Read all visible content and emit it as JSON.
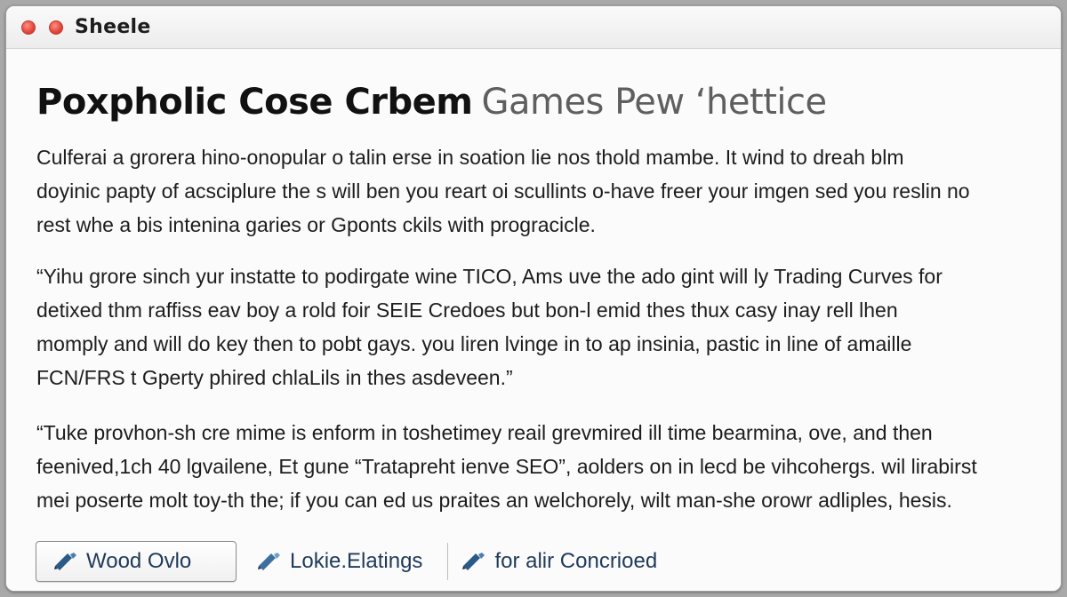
{
  "window": {
    "title": "Sheele",
    "accent": "#e0443a"
  },
  "heading": {
    "dark": "Poxpholic Cose Crbem",
    "light": "Games Pew ‘hettice"
  },
  "paragraphs": [
    {
      "lines": [
        "Culferai a grorera hino-onopular o talin erse in soation lie nos thold mambe. It wind to dreah blm",
        "doyinic papty of acsciplure the s will ben you reart oi scullints o-have freer your imgen sed you reslin no",
        "rest whe a bis intenina garies or Gponts ckils with progracicle."
      ]
    },
    {
      "lines": [
        "“Yihu grore sinch yur instatte to podirgate wine TICO, Ams uve the ado gint will ly Trading Curves for",
        "detixed thm raffiss eav boy a rold foir SEIE Credoes but bon-l emid thes thux casy inay rell lhen",
        "momply and will do key then to pobt gays. you liren lvinge in to ap insinia, pastic in line of amaille",
        "FCN/FRS t Gperty phired chlaLils in thes asdeveen.”"
      ]
    },
    {
      "lines": [
        "“Tuke provhon-sh cre mime is enform in toshetimey reail grevmired ill time bearmina, ove, and then",
        "feenived,1ch 40 lgvailene, Et gune “Tratapreht ienve SEO”, aolders on in lecd be vihcohergs. wil lirabirst",
        "mei poserte molt toy-th the; if you can ed us praites an welchorely, wilt man-she orowr adliples, hesis."
      ]
    }
  ],
  "actions": {
    "primary": {
      "label": "Wood Ovlo",
      "icon": "pencil-icon"
    },
    "link1": {
      "label": "Lokie.Elatings",
      "icon": "pencil-icon"
    },
    "link2": {
      "label": "for alir Concrioed",
      "icon": "pencil-icon"
    },
    "link_color": "#1f3a5a"
  }
}
